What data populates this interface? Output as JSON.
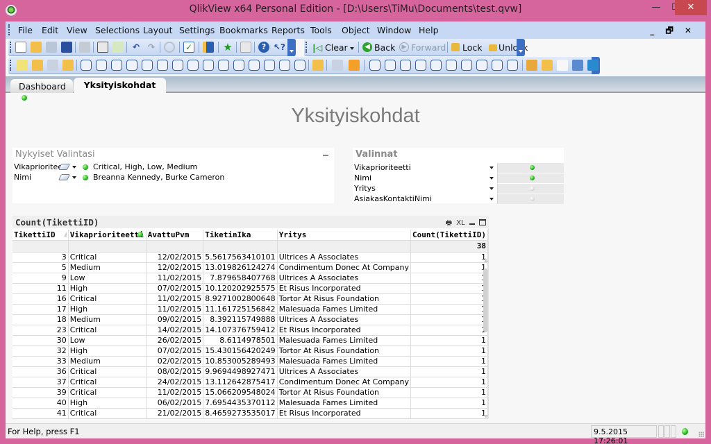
{
  "window": {
    "title": "QlikView x64 Personal Edition - [D:\\Users\\TiMu\\Documents\\test.qvw]",
    "minimize": "—",
    "maximize": "☐",
    "close": "✕"
  },
  "menubar": {
    "items": [
      "File",
      "Edit",
      "View",
      "Selections",
      "Layout",
      "Settings",
      "Bookmarks",
      "Reports",
      "Tools",
      "Object",
      "Window",
      "Help"
    ],
    "mdi_controls": "_ 🗗 ✕"
  },
  "toolbar_nav": {
    "clear": "Clear",
    "back": "Back",
    "forward": "Forward",
    "lock": "Lock",
    "unlock": "Unlock"
  },
  "tabs": [
    {
      "label": "Dashboard",
      "active": false,
      "has_indicator": true
    },
    {
      "label": "Yksityiskohdat",
      "active": true
    }
  ],
  "sheet": {
    "title": "Yksityiskohdat"
  },
  "current_selections": {
    "title": "Nykyiset Valintasi",
    "rows": [
      {
        "field": "Vikaprioriteetti",
        "values": "Critical, High, Low, Medium"
      },
      {
        "field": "Nimi",
        "values": "Breanna Kennedy, Burke Cameron"
      }
    ]
  },
  "multibox": {
    "title": "Valinnat",
    "rows": [
      {
        "field": "Vikaprioriteetti",
        "state": "selected"
      },
      {
        "field": "Nimi",
        "state": "selected"
      },
      {
        "field": "Yritys",
        "state": "none"
      },
      {
        "field": "AsiakasKontaktiNimi",
        "state": "none"
      }
    ]
  },
  "table": {
    "caption": "Count(TikettiID)",
    "caption_controls": {
      "print": "🖶",
      "xl": "XL"
    },
    "columns": [
      "TikettiID",
      "Vikaprioriteetti",
      "AvattuPvm",
      "TiketinIka",
      "Yritys",
      "Count(TikettiID)"
    ],
    "total": "38",
    "rows": [
      [
        "3",
        "Critical",
        "12/02/2015",
        "5.5617563410101",
        "Ultrices A Associates",
        "1"
      ],
      [
        "5",
        "Medium",
        "12/02/2015",
        "13.019826124274",
        "Condimentum Donec At Company",
        "1"
      ],
      [
        "9",
        "Low",
        "11/02/2015",
        "7.879658407768",
        "Ultrices A Associates",
        "1"
      ],
      [
        "11",
        "High",
        "07/02/2015",
        "10.120202925575",
        "Et Risus Incorporated",
        "1"
      ],
      [
        "16",
        "Critical",
        "11/02/2015",
        "8.9271002800648",
        "Tortor At Risus Foundation",
        "1"
      ],
      [
        "17",
        "High",
        "11/02/2015",
        "11.161725156842",
        "Malesuada Fames Limited",
        "1"
      ],
      [
        "18",
        "Medium",
        "09/02/2015",
        "8.392115749888",
        "Ultrices A Associates",
        "1"
      ],
      [
        "23",
        "Critical",
        "14/02/2015",
        "14.107376759412",
        "Et Risus Incorporated",
        "1"
      ],
      [
        "30",
        "Low",
        "26/02/2015",
        "8.6114978501",
        "Malesuada Fames Limited",
        "1"
      ],
      [
        "32",
        "High",
        "07/02/2015",
        "15.430156420249",
        "Tortor At Risus Foundation",
        "1"
      ],
      [
        "33",
        "Medium",
        "02/02/2015",
        "10.853005289493",
        "Malesuada Fames Limited",
        "1"
      ],
      [
        "36",
        "Critical",
        "08/02/2015",
        "9.9694498927471",
        "Ultrices A Associates",
        "1"
      ],
      [
        "37",
        "Critical",
        "24/02/2015",
        "13.112642875417",
        "Condimentum Donec At Company",
        "1"
      ],
      [
        "39",
        "Critical",
        "11/02/2015",
        "15.066209548024",
        "Tortor At Risus Foundation",
        "1"
      ],
      [
        "40",
        "High",
        "06/02/2015",
        "7.6954435370112",
        "Malesuada Fames Limited",
        "1"
      ],
      [
        "41",
        "Critical",
        "21/02/2015",
        "8.4659273535017",
        "Et Risus Incorporated",
        "1"
      ]
    ]
  },
  "statusbar": {
    "help_text": "For Help, press F1",
    "timestamp": "9.5.2015 17:26:01"
  },
  "colors": {
    "window_frame": "#d6659d",
    "menubar": "#c6d8f4",
    "selected_indicator": "#1fb31c",
    "close_button": "#c7494f"
  }
}
